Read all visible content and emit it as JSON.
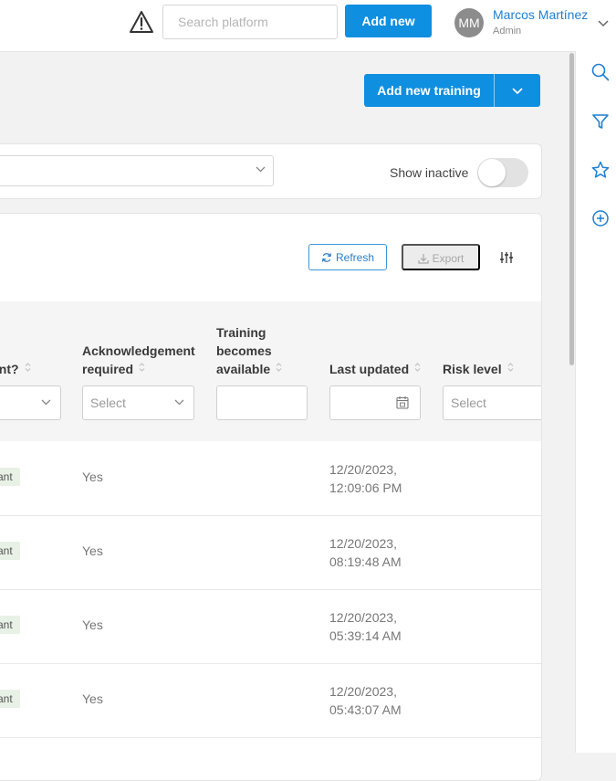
{
  "header": {
    "search_placeholder": "Search platform",
    "add_new_label": "Add new",
    "user": {
      "initials": "MM",
      "name": "Marcos Martínez",
      "role": "Admin"
    }
  },
  "sidebar": {
    "icons": [
      "search-icon",
      "filter-icon",
      "star-icon",
      "plus-circle-icon"
    ]
  },
  "toolbar": {
    "add_training_label": "Add new training"
  },
  "filters": {
    "show_inactive_label": "Show inactive",
    "show_inactive": false
  },
  "table": {
    "refresh_label": "Refresh",
    "export_label": "Export",
    "columns": {
      "compliant": "ant?",
      "ack_line1": "Acknowledgement",
      "ack_line2": "required",
      "avail_line1": "Training",
      "avail_line2": "becomes",
      "avail_line3": "available",
      "updated": "Last updated",
      "risk": "Risk level"
    },
    "filter_placeholder": "Select",
    "rows": [
      {
        "badge": "pliant",
        "ack": "Yes",
        "date": "12/20/2023,",
        "time": "12:09:06 PM"
      },
      {
        "badge": "pliant",
        "ack": "Yes",
        "date": "12/20/2023,",
        "time": "08:19:48 AM"
      },
      {
        "badge": "pliant",
        "ack": "Yes",
        "date": "12/20/2023,",
        "time": "05:39:14 AM"
      },
      {
        "badge": "pliant",
        "ack": "Yes",
        "date": "12/20/2023,",
        "time": "05:43:07 AM"
      }
    ]
  },
  "colors": {
    "primary": "#0f8fe0",
    "link": "#1f7fd0",
    "badge_bg": "#e8f1e5"
  }
}
